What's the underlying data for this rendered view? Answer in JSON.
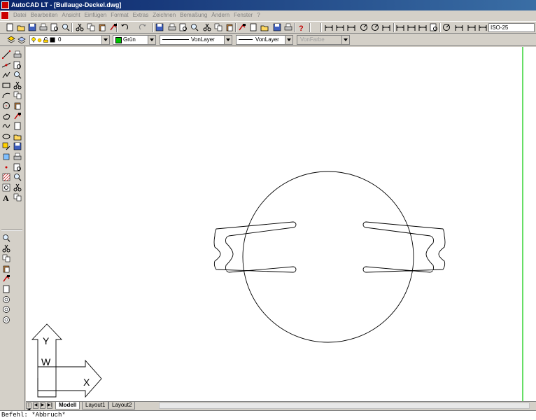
{
  "window": {
    "title": "AutoCAD LT - [Bullauge-Deckel.dwg]"
  },
  "menu": [
    "Datei",
    "Bearbeiten",
    "Ansicht",
    "Einfügen",
    "Format",
    "Extras",
    "Zeichnen",
    "Bemaßung",
    "Ändern",
    "Fenster",
    "?"
  ],
  "standard_toolbar": {
    "icons": [
      "new-icon",
      "open-icon",
      "save-icon",
      "print-icon",
      "print-preview-icon",
      "find-icon",
      "cut-icon",
      "copy-icon",
      "paste-icon",
      "match-properties-icon",
      "undo-icon",
      "redo-icon",
      "hyperlink-icon",
      "snap-icon",
      "osnap-icon",
      "ortho-icon",
      "tracking-icon",
      "object-snap-icon",
      "pan-icon",
      "zoom-realtime-icon",
      "zoom-window-icon",
      "zoom-previous-icon",
      "properties-icon",
      "design-center-icon",
      "help-icon",
      "linear-dim-icon",
      "aligned-dim-icon",
      "ordinate-dim-icon",
      "radius-dim-icon",
      "diameter-dim-icon",
      "angular-dim-icon",
      "quick-dim-icon",
      "baseline-dim-icon",
      "continue-dim-icon",
      "tolerance-icon",
      "center-mark-icon",
      "dim-edit-icon",
      "dim-text-edit-icon",
      "dim-update-icon"
    ],
    "dim_style": "ISO-25"
  },
  "properties_toolbar": {
    "layer": "0",
    "color": "Grün",
    "color_swatch": "#00c000",
    "linetype": "VonLayer",
    "lineweight": "VonLayer",
    "plotstyle": "VonFarbe"
  },
  "draw_tools": [
    "line-icon",
    "construction-line-icon",
    "polyline-icon",
    "rectangle-icon",
    "arc-icon",
    "circle-icon",
    "revision-cloud-icon",
    "spline-icon",
    "ellipse-icon",
    "insert-block-icon",
    "make-block-icon",
    "point-icon",
    "hatch-icon",
    "region-icon",
    "text-icon"
  ],
  "modify_tools": [
    "erase-icon",
    "copy-object-icon",
    "mirror-icon",
    "offset-icon",
    "array-icon",
    "move-icon",
    "rotate-icon",
    "scale-icon",
    "stretch-icon",
    "trim-icon",
    "extend-icon",
    "break-icon",
    "chamfer-icon",
    "fillet-icon",
    "explode-icon"
  ],
  "extra_tools": [
    "properties-panel-icon",
    "layer-icon",
    "edit-icon",
    "sketch-icon",
    "inquiry-icon",
    "measure-icon",
    "orbit-icon",
    "zoom-extents-icon",
    "zoom-all-icon"
  ],
  "tabs": [
    "Modell",
    "Layout1",
    "Layout2"
  ],
  "active_tab": "Modell",
  "ucs": {
    "x_label": "X",
    "y_label": "Y",
    "w_label": "W"
  },
  "command_line": "Befehl: *Abbruch*"
}
